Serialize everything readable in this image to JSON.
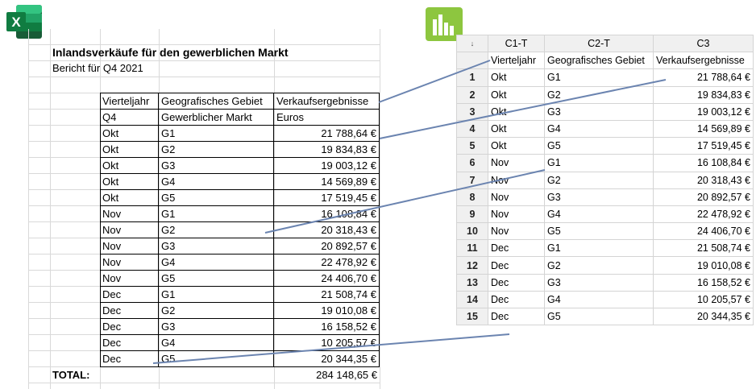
{
  "excel": {
    "title": "Inlandsverkäufe für den gewerblichen Markt",
    "subtitle": "Bericht für Q4 2021",
    "header_row": [
      "Vierteljahr",
      "Geografisches Gebiet",
      "Verkaufsergebnisse"
    ],
    "sub_header_row": [
      "Q4",
      "Gewerblicher Markt",
      "Euros"
    ],
    "rows": [
      [
        "Okt",
        "G1",
        "21 788,64 €"
      ],
      [
        "Okt",
        "G2",
        "19 834,83 €"
      ],
      [
        "Okt",
        "G3",
        "19 003,12 €"
      ],
      [
        "Okt",
        "G4",
        "14 569,89 €"
      ],
      [
        "Okt",
        "G5",
        "17 519,45 €"
      ],
      [
        "Nov",
        "G1",
        "16 108,84 €"
      ],
      [
        "Nov",
        "G2",
        "20 318,43 €"
      ],
      [
        "Nov",
        "G3",
        "20 892,57 €"
      ],
      [
        "Nov",
        "G4",
        "22 478,92 €"
      ],
      [
        "Nov",
        "G5",
        "24 406,70 €"
      ],
      [
        "Dec",
        "G1",
        "21 508,74 €"
      ],
      [
        "Dec",
        "G2",
        "19 010,08 €"
      ],
      [
        "Dec",
        "G3",
        "16 158,52 €"
      ],
      [
        "Dec",
        "G4",
        "10 205,57 €"
      ],
      [
        "Dec",
        "G5",
        "20 344,35 €"
      ]
    ],
    "total_label": "TOTAL:",
    "total_value": "284 148,65 €"
  },
  "minitab": {
    "corner": "↓",
    "column_ids": [
      "C1-T",
      "C2-T",
      "C3"
    ],
    "column_names": [
      "Vierteljahr",
      "Geografisches Gebiet",
      "Verkaufsergebnisse"
    ],
    "rows": [
      [
        "1",
        "Okt",
        "G1",
        "21 788,64 €"
      ],
      [
        "2",
        "Okt",
        "G2",
        "19 834,83 €"
      ],
      [
        "3",
        "Okt",
        "G3",
        "19 003,12 €"
      ],
      [
        "4",
        "Okt",
        "G4",
        "14 569,89 €"
      ],
      [
        "5",
        "Okt",
        "G5",
        "17 519,45 €"
      ],
      [
        "6",
        "Nov",
        "G1",
        "16 108,84 €"
      ],
      [
        "7",
        "Nov",
        "G2",
        "20 318,43 €"
      ],
      [
        "8",
        "Nov",
        "G3",
        "20 892,57 €"
      ],
      [
        "9",
        "Nov",
        "G4",
        "22 478,92 €"
      ],
      [
        "10",
        "Nov",
        "G5",
        "24 406,70 €"
      ],
      [
        "11",
        "Dec",
        "G1",
        "21 508,74 €"
      ],
      [
        "12",
        "Dec",
        "G2",
        "19 010,08 €"
      ],
      [
        "13",
        "Dec",
        "G3",
        "16 158,52 €"
      ],
      [
        "14",
        "Dec",
        "G4",
        "10 205,57 €"
      ],
      [
        "15",
        "Dec",
        "G5",
        "20 344,35 €"
      ]
    ]
  },
  "icons": {
    "excel_letter": "X",
    "excel_icon": "excel-logo-icon",
    "minitab_icon": "minitab-logo-icon"
  },
  "colors": {
    "excel_green": "#1d6f42",
    "excel_green_light": "#33c481",
    "minitab_green": "#8dc63f",
    "connector": "#6b84b0"
  }
}
